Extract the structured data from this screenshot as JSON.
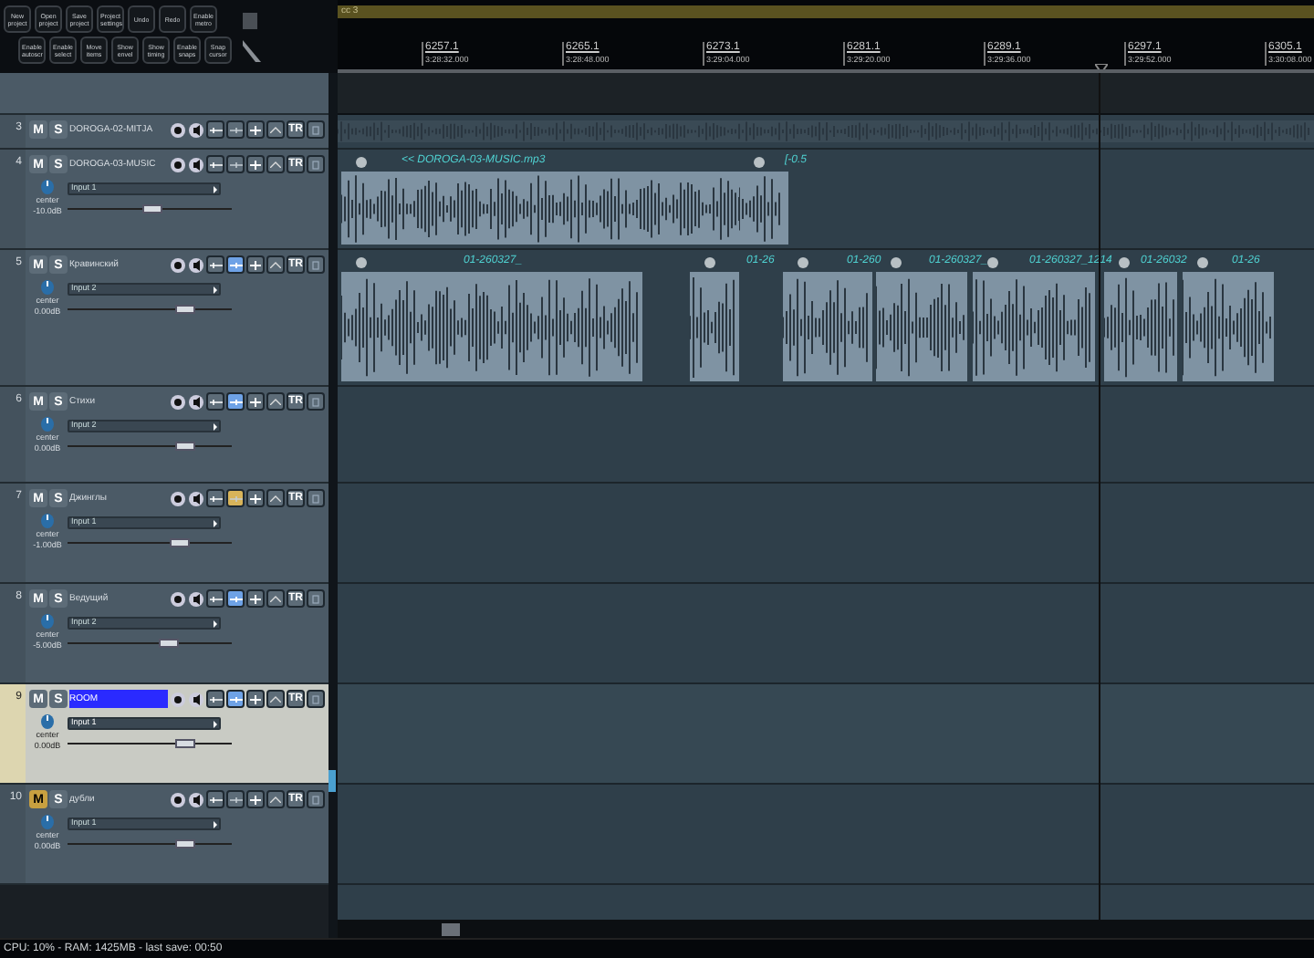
{
  "toolbar": {
    "rows": [
      [
        "New project",
        "Open project",
        "Save project",
        "Project settings",
        "Undo",
        "Redo",
        "Enable metro"
      ],
      [
        "Enable autoscr",
        "Enable select",
        "Move items",
        "Show envel",
        "Show timing",
        "Enable snaps",
        "Snap cursor"
      ]
    ]
  },
  "marker_bar": {
    "label": "cc 3"
  },
  "ruler": {
    "marks": [
      {
        "bar": "6257.1",
        "time": "3:28:32.000"
      },
      {
        "bar": "6265.1",
        "time": "3:28:48.000"
      },
      {
        "bar": "6273.1",
        "time": "3:29:04.000"
      },
      {
        "bar": "6281.1",
        "time": "3:29:20.000"
      },
      {
        "bar": "6289.1",
        "time": "3:29:36.000"
      },
      {
        "bar": "6297.1",
        "time": "3:29:52.000"
      },
      {
        "bar": "6305.1",
        "time": "3:30:08.000"
      }
    ]
  },
  "tracks": [
    {
      "number": "3",
      "name": "DOROGA-02-MITJA",
      "mute_label": "M",
      "solo_label": "S",
      "tr_label": "TR",
      "expanded": false,
      "selected": false,
      "muted": false,
      "monitoring": false,
      "auto_monitor": false
    },
    {
      "number": "4",
      "name": "DOROGA-03-MUSIC",
      "mute_label": "M",
      "solo_label": "S",
      "tr_label": "TR",
      "expanded": true,
      "selected": false,
      "muted": false,
      "monitoring": false,
      "auto_monitor": false,
      "pan": "center",
      "volume": "-10.0dB",
      "input": "Input 1",
      "level": 0.51,
      "clips": [
        {
          "label": "<< DOROGA-03-MUSIC.mp3"
        },
        {
          "label": "[-0.5"
        }
      ]
    },
    {
      "number": "5",
      "name": "Кравинский",
      "mute_label": "M",
      "solo_label": "S",
      "tr_label": "TR",
      "expanded": true,
      "selected": false,
      "muted": false,
      "monitoring": true,
      "auto_monitor": false,
      "pan": "center",
      "volume": "0.00dB",
      "input": "Input 2",
      "level": 0.71,
      "clips": [
        {
          "label": "01-260327_"
        },
        {
          "label": "01-26"
        },
        {
          "label": "01-260"
        },
        {
          "label": "01-260327_"
        },
        {
          "label": "01-260327_1214"
        },
        {
          "label": "01-26032"
        },
        {
          "label": "01-26"
        }
      ]
    },
    {
      "number": "6",
      "name": "Стихи",
      "mute_label": "M",
      "solo_label": "S",
      "tr_label": "TR",
      "expanded": true,
      "selected": false,
      "muted": false,
      "monitoring": true,
      "auto_monitor": false,
      "pan": "center",
      "volume": "0.00dB",
      "input": "Input 2",
      "level": 0.71
    },
    {
      "number": "7",
      "name": "Джинглы",
      "mute_label": "M",
      "solo_label": "S",
      "tr_label": "TR",
      "expanded": true,
      "selected": false,
      "muted": false,
      "monitoring": false,
      "auto_monitor": true,
      "pan": "center",
      "volume": "-1.00dB",
      "input": "Input 1",
      "level": 0.68
    },
    {
      "number": "8",
      "name": "Ведущий",
      "mute_label": "M",
      "solo_label": "S",
      "tr_label": "TR",
      "expanded": true,
      "selected": false,
      "muted": false,
      "monitoring": true,
      "auto_monitor": false,
      "pan": "center",
      "volume": "-5.00dB",
      "input": "Input 2",
      "level": 0.61
    },
    {
      "number": "9",
      "name": "ROOM",
      "mute_label": "M",
      "solo_label": "S",
      "tr_label": "TR",
      "expanded": true,
      "selected": true,
      "muted": false,
      "monitoring": true,
      "auto_monitor": false,
      "pan": "center",
      "volume": "0.00dB",
      "input": "Input 1",
      "level": 0.71
    },
    {
      "number": "10",
      "name": "дубли",
      "mute_label": "M",
      "solo_label": "S",
      "tr_label": "TR",
      "expanded": true,
      "selected": false,
      "muted": true,
      "monitoring": false,
      "auto_monitor": false,
      "pan": "center",
      "volume": "0.00dB",
      "input": "Input 1",
      "level": 0.71
    }
  ],
  "status_bar": {
    "text": "CPU: 10% - RAM: 1425MB - last save: 00:50"
  }
}
